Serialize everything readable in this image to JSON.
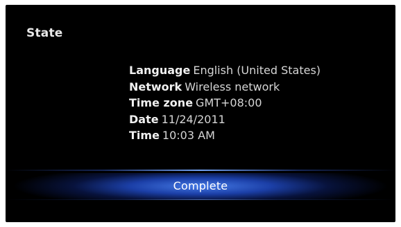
{
  "screen": {
    "title": "State"
  },
  "summary": [
    {
      "label": "Language",
      "value": "English (United States)"
    },
    {
      "label": "Network",
      "value": "Wireless network"
    },
    {
      "label": "Time zone",
      "value": "GMT+08:00"
    },
    {
      "label": "Date",
      "value": "11/24/2011"
    },
    {
      "label": "Time",
      "value": "10:03 AM"
    }
  ],
  "actions": {
    "complete_label": "Complete"
  },
  "colors": {
    "background": "#000000",
    "text": "#d6d6d6",
    "highlight": "#4880f2"
  }
}
